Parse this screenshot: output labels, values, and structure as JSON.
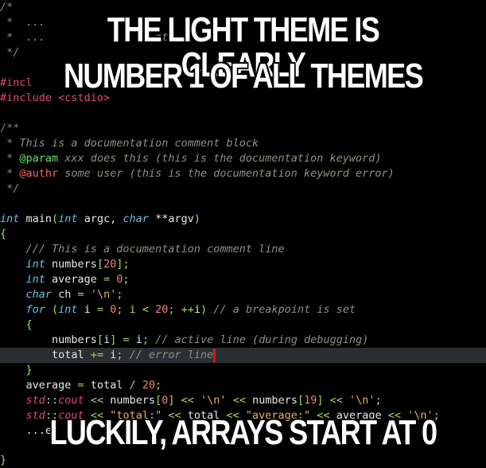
{
  "meme": {
    "top_line1": "THE LIGHT THEME IS CLEARLY",
    "top_line2": "NUMBER 1 OF ALL THEMES",
    "bottom_line": "LUCKILY, ARRAYS START AT 0"
  },
  "code": {
    "l01": "/*",
    "l02": " *  ...",
    "l03": " *  ...              ...nt",
    "l04": " */",
    "l06a": "#incl",
    "l07": "#include <cstdio>",
    "doc1": "/**",
    "doc2": " * This is a documentation comment block",
    "doc3_star": " * ",
    "doc3_tag": "@param",
    "doc3_rest": " xxx does this (this is the documentation keyword)",
    "doc4_star": " * ",
    "doc4_tag": "@authr",
    "doc4_rest": " some user (this is the documentation keyword error)",
    "doc5": " */",
    "main_kw": "int",
    "main_name": " main",
    "main_paren": "(",
    "main_kw2": "int",
    "main_argc": " argc, ",
    "main_kw3": "char",
    "main_argv": " **argv",
    "main_close": ")",
    "brace_open": "{",
    "c1": "    /// This is a documentation comment line",
    "c2_kw": "int",
    "c2_rest": " numbers",
    "c2_b1": "[",
    "c2_n": "20",
    "c2_b2": "];",
    "c3_kw": "int",
    "c3_rest": " average ",
    "c3_eq": "=",
    "c3_n": "0",
    "c3_end": ";",
    "c4_kw": "char",
    "c4_rest": " ch ",
    "c4_eq": "=",
    "c4_s": "'\\n'",
    "c4_end": ";",
    "c5_kw": "for",
    "c5_p": " (",
    "c5_kw2": "int",
    "c5_a": " i ",
    "c5_eq": "=",
    "c5_n0": "0",
    "c5_b": "; i ",
    "c5_lt": "<",
    "c5_n20": "20",
    "c5_c": "; ",
    "c5_inc": "++",
    "c5_i": "i",
    "c5_close": ")",
    "c5_cm": " // a breakpoint is set",
    "c6": "    {",
    "c7_a": "numbers",
    "c7_b1": "[",
    "c7_i": "i",
    "c7_b2": "]",
    "c7_eq": "=",
    "c7_r": " i",
    "c7_semi": ";",
    "c7_cm": " // active line (during debugging)",
    "c8_a": "total ",
    "c8_op": "+=",
    "c8_r": " i",
    "c8_semi": ";",
    "c8_cm": " // error line",
    "c9": "    }",
    "c10_a": "average ",
    "c10_eq": "=",
    "c10_b": " total ",
    "c10_div": "/",
    "c10_n": "20",
    "c10_end": ";",
    "c11_std": "std",
    "c11_cc": "::",
    "c11_cout": "cout",
    "c11_op1": " << ",
    "c11_a": "numbers",
    "c11_b1": "[",
    "c11_n0": "0",
    "c11_b2": "]",
    "c11_op2": " << ",
    "c11_s1": "'\\n'",
    "c11_op3": " << ",
    "c11_b": "numbers",
    "c11_b3": "[",
    "c11_n19": "19",
    "c11_b4": "]",
    "c11_op4": " << ",
    "c11_s2": "'\\n'",
    "c11_end": ";",
    "c12_std": "std",
    "c12_cc": "::",
    "c12_cout": "cout",
    "c12_op1": " << ",
    "c12_s1": "\"total:\"",
    "c12_op2": " << ",
    "c12_a": "total",
    "c12_op3": " << ",
    "c12_s2": "\"average:\"",
    "c12_op4": " << ",
    "c12_b": "average",
    "c12_op5": " << ",
    "c12_s3": "'\\n'",
    "c12_end": ";",
    "c13": "    ...es",
    "brace_close": "}"
  }
}
